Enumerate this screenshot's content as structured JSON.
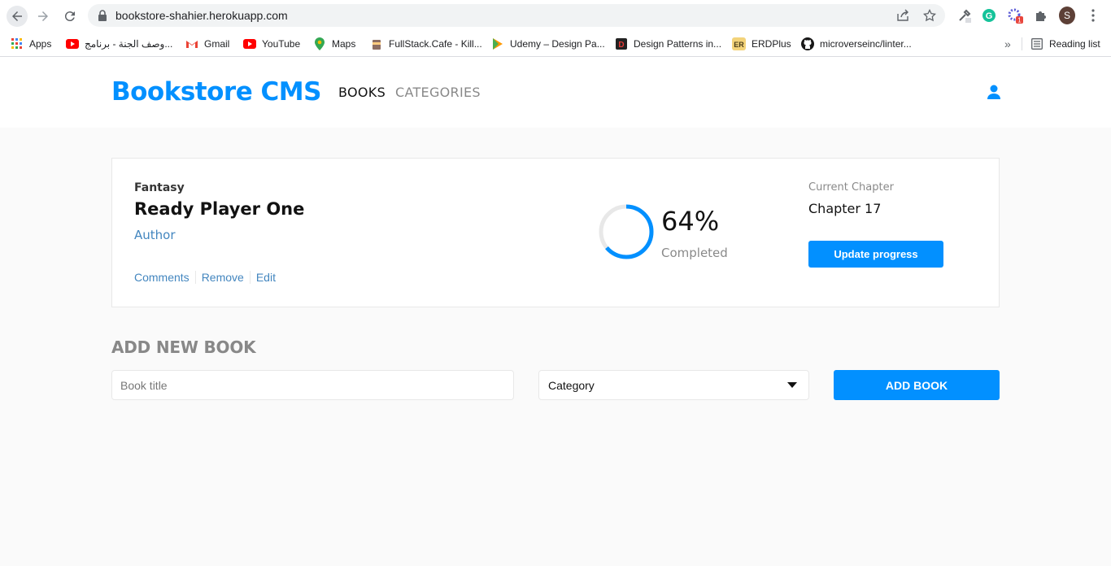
{
  "browser": {
    "url": "bookstore-shahier.herokuapp.com",
    "profile_initial": "S",
    "extension_badge": "1",
    "bookmarks": [
      {
        "label": "Apps",
        "icon": "apps-grid-icon"
      },
      {
        "label": "وصف الجنة - برنامج...",
        "icon": "youtube-icon"
      },
      {
        "label": "Gmail",
        "icon": "gmail-icon"
      },
      {
        "label": "YouTube",
        "icon": "youtube-icon"
      },
      {
        "label": "Maps",
        "icon": "maps-pin-icon"
      },
      {
        "label": "FullStack.Cafe - Kill...",
        "icon": "cafe-cup-icon"
      },
      {
        "label": "Udemy – Design Pa...",
        "icon": "udemy-icon"
      },
      {
        "label": "Design Patterns in...",
        "icon": "design-patterns-icon"
      },
      {
        "label": "ERDPlus",
        "icon": "erdplus-icon"
      },
      {
        "label": "microverseinc/linter...",
        "icon": "github-icon"
      }
    ],
    "overflow_label": "»",
    "reading_list_label": "Reading list"
  },
  "header": {
    "brand": "Bookstore CMS",
    "nav": [
      {
        "label": "BOOKS",
        "active": true
      },
      {
        "label": "CATEGORIES",
        "active": false
      }
    ]
  },
  "books": [
    {
      "genre": "Fantasy",
      "title": "Ready Player One",
      "author": "Author",
      "actions": [
        "Comments",
        "Remove",
        "Edit"
      ],
      "progress_percent": 64,
      "progress_label": "64%",
      "completed_label": "Completed",
      "current_chapter_label": "Current Chapter",
      "current_chapter": "Chapter 17",
      "update_button": "Update progress"
    }
  ],
  "add_form": {
    "heading": "ADD NEW BOOK",
    "title_placeholder": "Book title",
    "category_value": "Category",
    "submit_label": "ADD BOOK"
  },
  "colors": {
    "accent": "#0290ff",
    "link": "#4386bf",
    "progress_track": "#e8e8e8"
  }
}
